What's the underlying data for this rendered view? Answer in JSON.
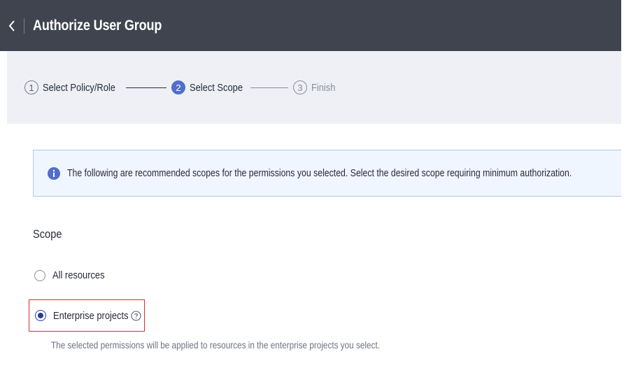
{
  "header": {
    "title": "Authorize User Group",
    "back_icon": "chevron-left-icon"
  },
  "steps": [
    {
      "number": "1",
      "label": "Select Policy/Role",
      "state": "done"
    },
    {
      "number": "2",
      "label": "Select Scope",
      "state": "active"
    },
    {
      "number": "3",
      "label": "Finish",
      "state": "pending"
    }
  ],
  "notice": {
    "icon": "info-icon",
    "text": "The following are recommended scopes for the permissions you selected. Select the desired scope requiring minimum authorization."
  },
  "scope": {
    "label": "Scope",
    "options": [
      {
        "label": "All resources",
        "selected": false
      },
      {
        "label": "Enterprise projects",
        "selected": true,
        "help_icon": "question-circle-icon"
      }
    ],
    "description": "The selected permissions will be applied to resources in the enterprise projects you select."
  },
  "colors": {
    "header_bg": "#3f444f",
    "step_active": "#526ecc",
    "notice_bg": "#f0f6ff",
    "notice_border": "#aec8ee",
    "info_icon": "#526ecc",
    "radio_checked": "#253a9a",
    "highlight_border": "#e02b2b"
  }
}
